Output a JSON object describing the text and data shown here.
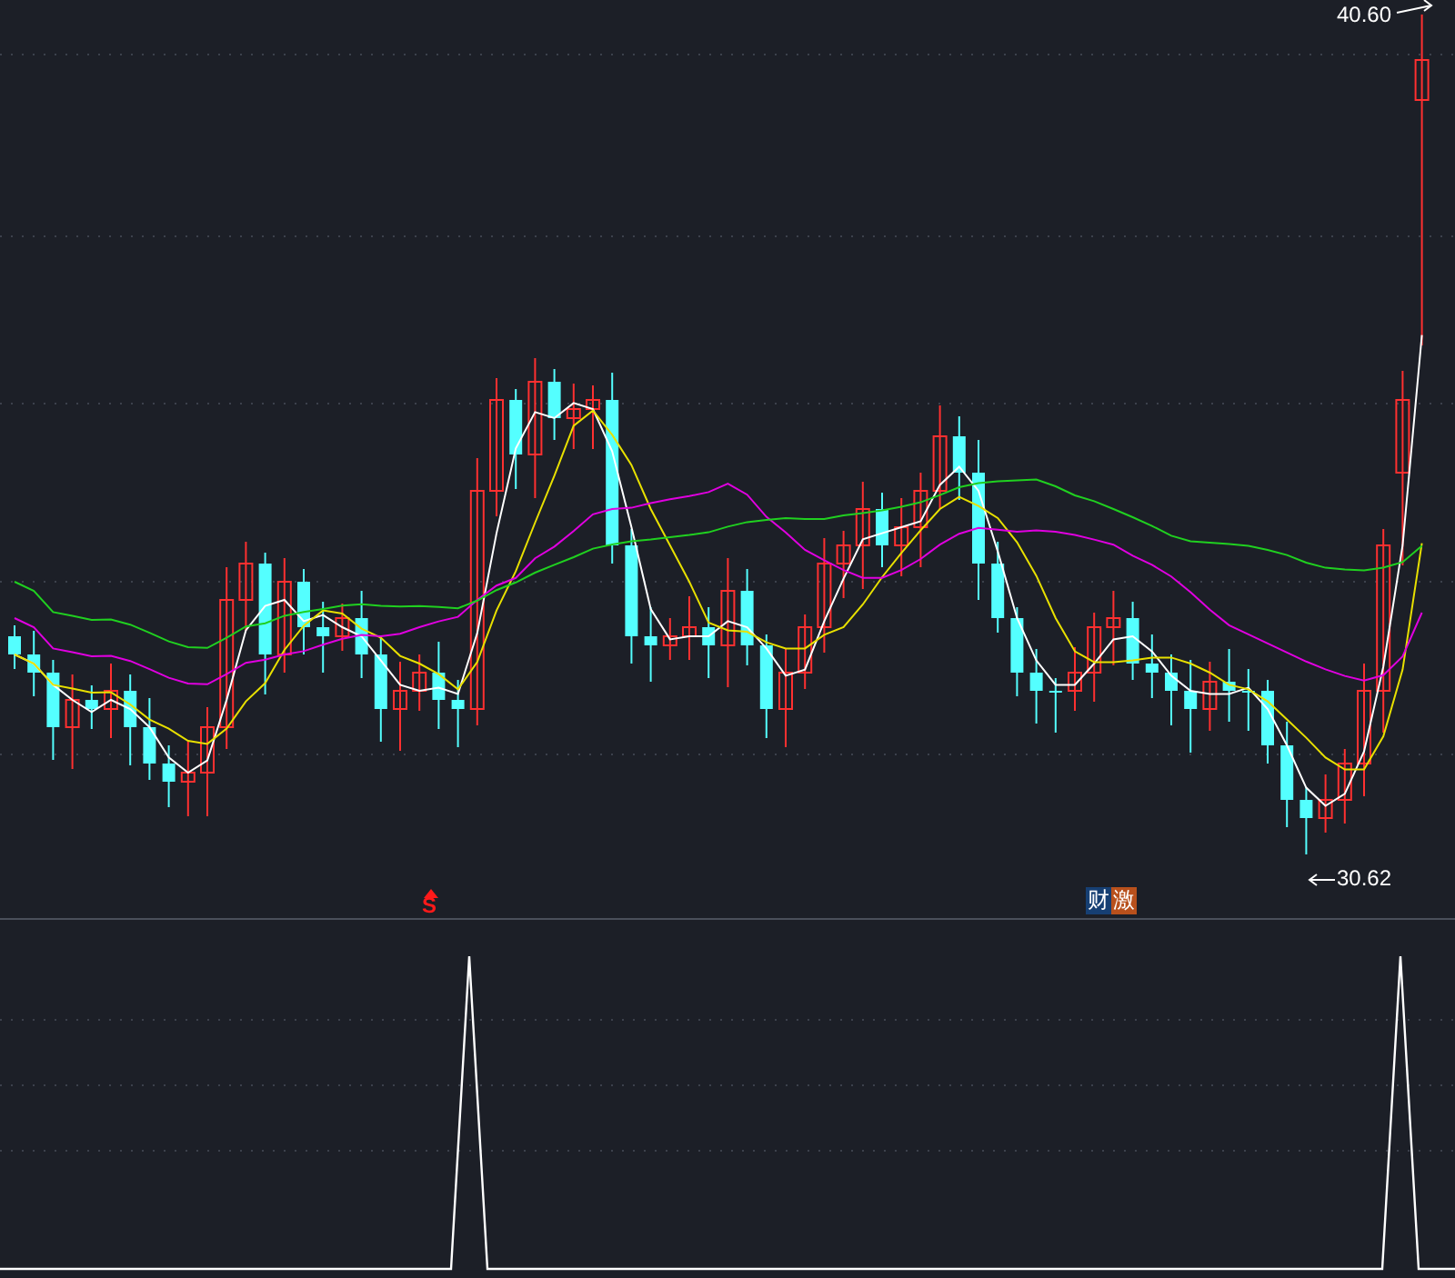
{
  "chart": {
    "price_labels": [
      {
        "kind": "high",
        "text": "40.60"
      },
      {
        "kind": "low",
        "text": "30.62"
      }
    ],
    "signal_marker": {
      "text": "S"
    },
    "event_badges": [
      {
        "text": "财",
        "color": "#163f73"
      },
      {
        "text": "激",
        "color": "#b8501c"
      }
    ]
  }
}
